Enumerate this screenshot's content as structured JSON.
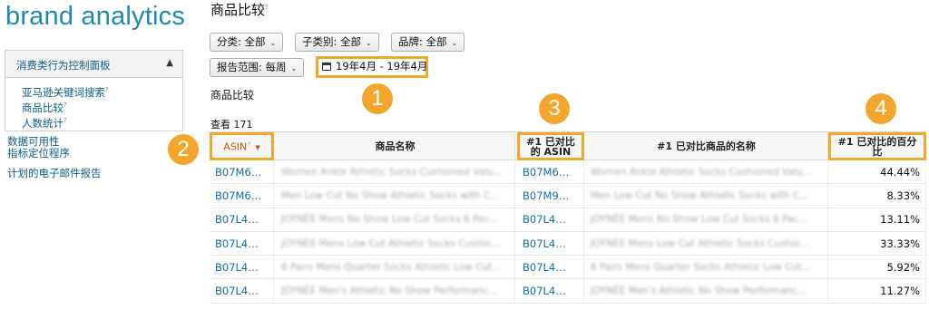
{
  "brand": {
    "title": "brand analytics"
  },
  "sidebar": {
    "panel_title": "消费类行为控制面板",
    "panel_items": [
      {
        "label": "亚马逊关键词搜索",
        "mark": "?"
      },
      {
        "label": "商品比较",
        "mark": "?"
      },
      {
        "label": "人数统计",
        "mark": "?"
      }
    ],
    "links": [
      "数据可用性",
      "指标定位程序",
      "计划的电子邮件报告"
    ]
  },
  "header": {
    "page_title": "商品比较",
    "page_title_mark": "?"
  },
  "filters": {
    "category": "分类: 全部",
    "subcategory": "子类别: 全部",
    "brand": "品牌: 全部",
    "report_range": "报告范围: 每周",
    "date_range": "19年4月 - 19年4月"
  },
  "section": {
    "subtitle": "商品比较",
    "view_count": "查看 171"
  },
  "callouts": [
    "1",
    "2",
    "3",
    "4"
  ],
  "table": {
    "columns": [
      "ASIN",
      "商品名称",
      "#1 已对比的 ASIN",
      "#1 已对比商品的名称",
      "#1 已对比的百分比"
    ],
    "rows": [
      {
        "asin": "B07M6…",
        "name": "Women Ankle Athletic Socks Cushioned Valu…",
        "compared_asin": "B07M6…",
        "compared_name": "Women Ankle Athletic Socks Cushioned Valu…",
        "percent": "44.44%"
      },
      {
        "asin": "B07M6…",
        "name": "Men Low Cut No Show Athletic Socks with C…",
        "compared_asin": "B07M9…",
        "compared_name": "Men Low Cut No Show Athletic Socks with C…",
        "percent": "8.33%"
      },
      {
        "asin": "B07L4…",
        "name": "JOYNÉE Mens No Show Low Cut Socks 6 Pac…",
        "compared_asin": "B07L4…",
        "compared_name": "JOYNÉE Mens No Show Low Cut Socks 6 Pac…",
        "percent": "13.11%"
      },
      {
        "asin": "B07L4…",
        "name": "JOYNÉE Mens Low Cut Athletic Socks Cushio…",
        "compared_asin": "B07L4…",
        "compared_name": "JOYNÉE Mens Low Cut Athletic Socks Cushio…",
        "percent": "33.33%"
      },
      {
        "asin": "B07L4…",
        "name": "6 Pairs Mens Quarter Socks Athletic Low Cut…",
        "compared_asin": "B07L4…",
        "compared_name": "6 Pairs Mens Quarter Socks Athletic Low Cut…",
        "percent": "5.92%"
      },
      {
        "asin": "B07L4…",
        "name": "JOYNÉE Men's Athletic No Show Performanc…",
        "compared_asin": "B07L4…",
        "compared_name": "JOYNÉE Men's Athletic No Show Performanc…",
        "percent": "11.27%"
      }
    ]
  },
  "colors": {
    "brand": "#1f89b5",
    "link": "#0f6fa3",
    "highlight": "#f0a92b",
    "callout": "#f4a52b"
  },
  "icons": [
    "chevron-up-icon",
    "calendar-icon",
    "caret-down-icon",
    "sort-caret-icon"
  ]
}
